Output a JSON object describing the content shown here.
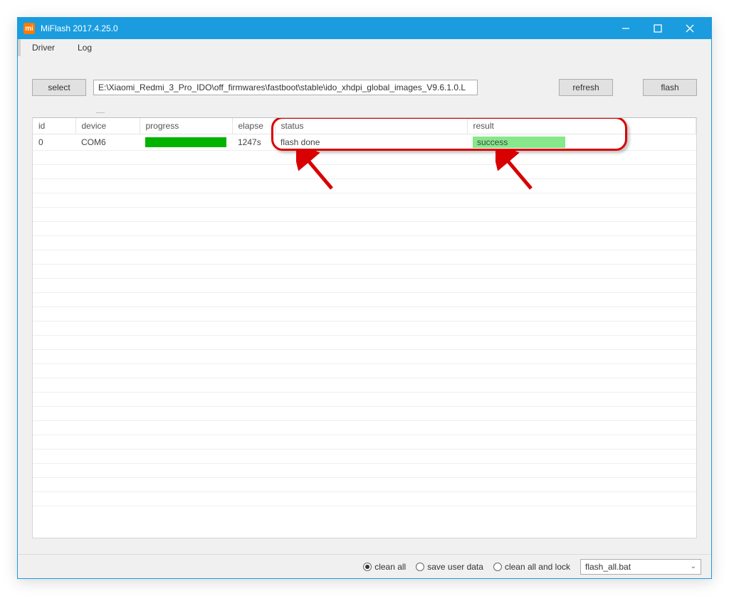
{
  "window": {
    "title": "MiFlash 2017.4.25.0",
    "icon_glyph": "mi"
  },
  "menu": {
    "driver": "Driver",
    "log": "Log"
  },
  "toolbar": {
    "select_label": "select",
    "path_value": "E:\\Xiaomi_Redmi_3_Pro_IDO\\off_firmwares\\fastboot\\stable\\ido_xhdpi_global_images_V9.6.1.0.L",
    "refresh_label": "refresh",
    "flash_label": "flash"
  },
  "table": {
    "headers": {
      "id": "id",
      "device": "device",
      "progress": "progress",
      "elapse": "elapse",
      "status": "status",
      "result": "result"
    },
    "rows": [
      {
        "id": "0",
        "device": "COM6",
        "progress_pct": 100,
        "elapse": "1247s",
        "status": "flash done",
        "result": "success"
      }
    ]
  },
  "footer": {
    "radios": {
      "clean_all": "clean all",
      "save_user_data": "save user data",
      "clean_all_lock": "clean all and lock"
    },
    "selected_radio": "clean_all",
    "file_select_value": "flash_all.bat"
  }
}
